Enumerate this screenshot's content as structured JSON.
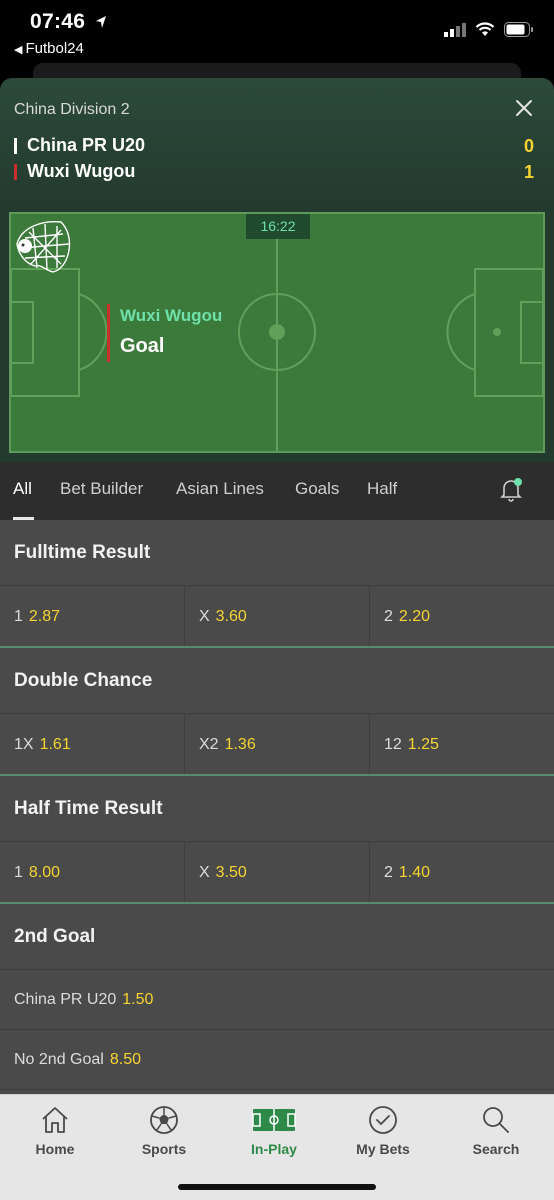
{
  "status_bar": {
    "time": "07:46",
    "back_label": "Futbol24"
  },
  "header": {
    "league": "China Division 2",
    "team1": {
      "name": "China PR U20",
      "score": "0",
      "color": "#ffffff"
    },
    "team2": {
      "name": "Wuxi Wugou",
      "score": "1",
      "color": "#c9302c"
    }
  },
  "pitch": {
    "clock": "16:22",
    "event_team": "Wuxi Wugou",
    "event_type": "Goal"
  },
  "tabs": [
    "All",
    "Bet Builder",
    "Asian Lines",
    "Goals",
    "Half"
  ],
  "markets": [
    {
      "title": "Fulltime Result",
      "odds": [
        {
          "label": "1",
          "price": "2.87"
        },
        {
          "label": "X",
          "price": "3.60"
        },
        {
          "label": "2",
          "price": "2.20"
        }
      ]
    },
    {
      "title": "Double Chance",
      "odds": [
        {
          "label": "1X",
          "price": "1.61"
        },
        {
          "label": "X2",
          "price": "1.36"
        },
        {
          "label": "12",
          "price": "1.25"
        }
      ]
    },
    {
      "title": "Half Time Result",
      "odds": [
        {
          "label": "1",
          "price": "8.00"
        },
        {
          "label": "X",
          "price": "3.50"
        },
        {
          "label": "2",
          "price": "1.40"
        }
      ]
    }
  ],
  "second_goal": {
    "title": "2nd Goal",
    "rows": [
      {
        "label": "China PR U20",
        "price": "1.50"
      },
      {
        "label": "No 2nd Goal",
        "price": "8.50"
      }
    ]
  },
  "bottom_nav": [
    {
      "label": "Home",
      "icon": "home-icon"
    },
    {
      "label": "Sports",
      "icon": "ball-icon"
    },
    {
      "label": "In-Play",
      "icon": "pitch-icon"
    },
    {
      "label": "My Bets",
      "icon": "check-circle-icon"
    },
    {
      "label": "Search",
      "icon": "search-icon"
    }
  ],
  "colors": {
    "accent": "#2f8a4a",
    "price": "#f5d432",
    "live_green": "#6fe0a9"
  }
}
